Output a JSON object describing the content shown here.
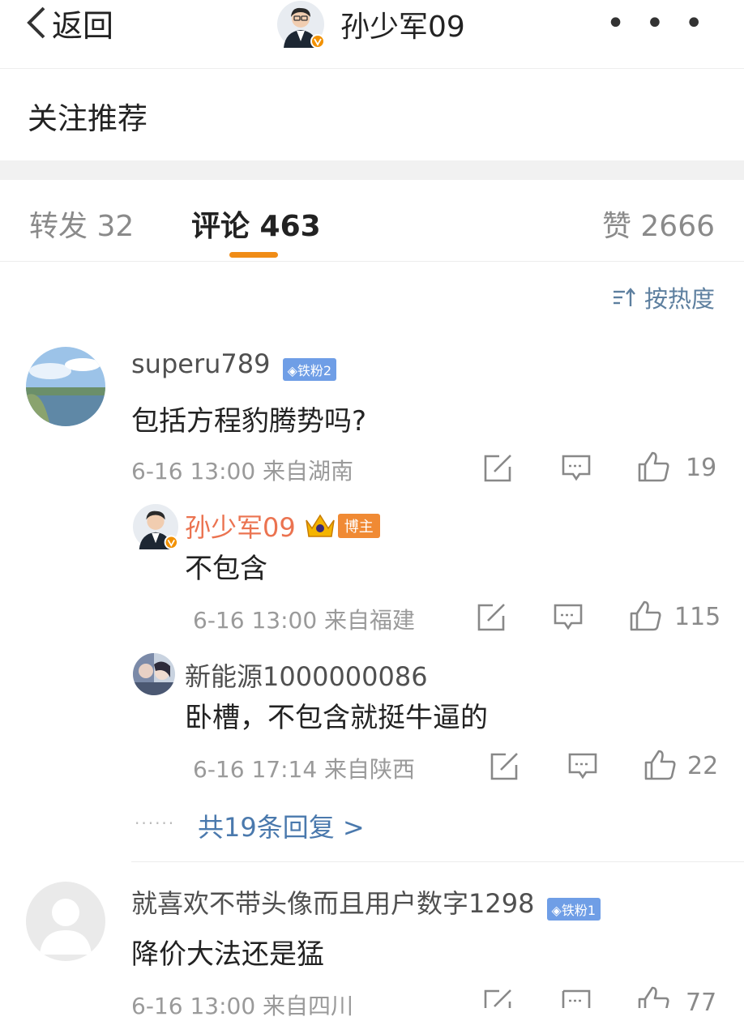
{
  "header": {
    "back_label": "返回",
    "username": "孙少军09",
    "more_label": "• • •"
  },
  "follow_recommend": "关注推荐",
  "tabs": [
    {
      "label": "转发 32"
    },
    {
      "label": "评论 463"
    },
    {
      "label": "赞 2666"
    }
  ],
  "sort_label": "按热度",
  "comments": [
    {
      "user": "superu789",
      "badge": "◈铁粉2",
      "text": "包括方程豹腾势吗?",
      "meta": "6-16 13:00 来自湖南",
      "likes": "19"
    },
    {
      "user": "孙少军09",
      "badge": "博主",
      "text": "不包含",
      "meta": "6-16 13:00 来自福建",
      "likes": "115"
    },
    {
      "user": "新能源1000000086",
      "text": "卧槽，不包含就挺牛逼的",
      "meta": "6-16 17:14 来自陕西",
      "likes": "22"
    },
    {
      "user": "就喜欢不带头像而且用户数字1298",
      "badge": "◈铁粉1",
      "text": "降价大法还是猛",
      "meta": "6-16 13:00 来自四川",
      "likes": "77"
    }
  ],
  "more_replies": "共19条回复 >",
  "colors": {
    "accent": "#f08c16",
    "link": "#4a79ad",
    "host_name": "#eb7350",
    "fan_badge": "#6f9ee6"
  }
}
